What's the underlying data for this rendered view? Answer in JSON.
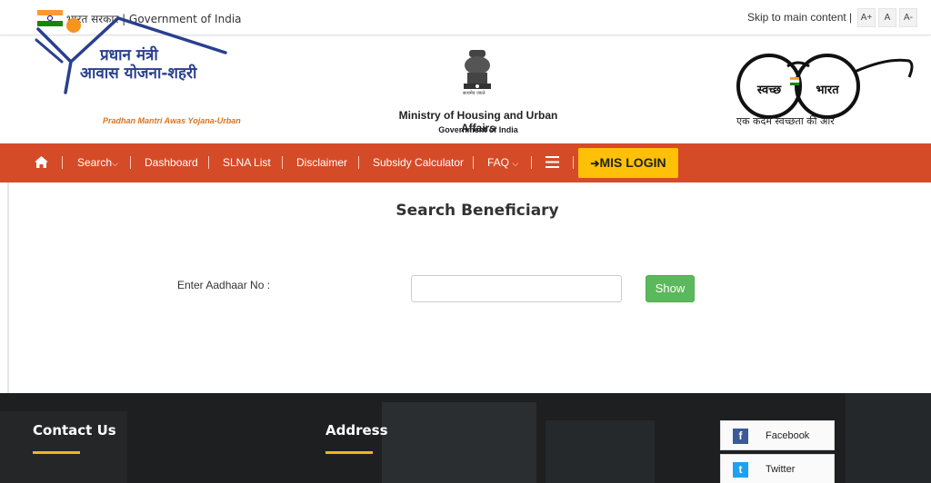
{
  "topbar": {
    "gov_text": "भारत सरकार | Government of India",
    "skip_link": "Skip to main content |",
    "font_buttons": [
      "A+",
      "A",
      "A-"
    ]
  },
  "header": {
    "pmay_hindi_line1": "प्रधान मंत्री",
    "pmay_hindi_line2": "आवास योजना-शहरी",
    "pmay_english": "Pradhan Mantri Awas Yojana-Urban",
    "ministry": "Ministry of Housing and Urban Affairs",
    "government": "Government of India",
    "emblem_caption": "सत्यमेव जयते",
    "swachh_left": "स्वच्छ",
    "swachh_right": "भारत",
    "swachh_tagline": "एक कदम स्वच्छता की ओर"
  },
  "nav": {
    "home_icon": "home-icon",
    "items": [
      "Search",
      "Dashboard",
      "SLNA List",
      "Disclaimer",
      "Subsidy Calculator",
      "FAQ"
    ],
    "menu_icon": "hamburger-icon",
    "mis_login": "MIS LOGIN",
    "mis_icon": "sign-in-icon"
  },
  "main": {
    "title": "Search Beneficiary",
    "aadhaar_label": "Enter Aadhaar No :",
    "aadhaar_value": "",
    "aadhaar_placeholder": "",
    "show_button": "Show"
  },
  "footer": {
    "contact_heading": "Contact Us",
    "address_heading": "Address",
    "social": [
      {
        "label": "Facebook",
        "icon": "facebook-icon"
      },
      {
        "label": "Twitter",
        "icon": "twitter-icon"
      }
    ]
  },
  "colors": {
    "nav_bg": "#d54b27",
    "mis_login_bg": "#ffc107",
    "show_button_bg": "#5cb85c",
    "footer_bg": "#1d1f21",
    "footer_accent": "#f0b323"
  }
}
